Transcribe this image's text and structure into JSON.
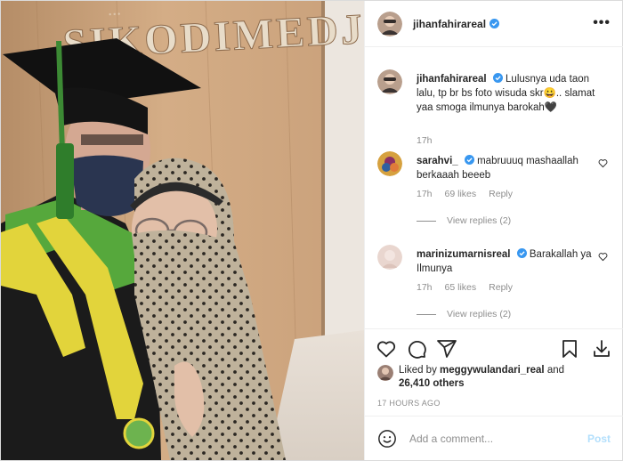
{
  "photo": {
    "sign_text": "SIKODIMEDJO",
    "description_icon": "graduation-selfie-photo"
  },
  "header": {
    "username": "jihanfahirareal",
    "verified_icon": "verified-badge-icon",
    "more_icon": "more-options-icon"
  },
  "caption": {
    "username": "jihanfahirareal",
    "text": "Lulusnya uda taon lalu, tp br bs foto wisuda skr😀.. slamat yaa smoga ilmunya barokah🖤",
    "time": "17h"
  },
  "comments": [
    {
      "username": "sarahvi_",
      "verified": true,
      "text": "mabruuuq mashaallah berkaaah beeeb",
      "time": "17h",
      "likes": "69 likes",
      "reply_label": "Reply",
      "view_replies": "View replies (2)"
    },
    {
      "username": "marinizumarnisreal",
      "verified": true,
      "text": "Barakallah ya Ilmunya",
      "time": "17h",
      "likes": "65 likes",
      "reply_label": "Reply",
      "view_replies": "View replies (2)"
    }
  ],
  "actions": {
    "like_icon": "heart-icon",
    "comment_icon": "comment-icon",
    "share_icon": "share-icon",
    "save_icon": "bookmark-icon",
    "download_icon": "download-icon"
  },
  "likes": {
    "prefix": "Liked by ",
    "user": "meggywulandari_real",
    "and": " and",
    "count": "26,410 others"
  },
  "timestamp": "17 HOURS AGO",
  "add_comment": {
    "placeholder": "Add a comment...",
    "post_label": "Post"
  },
  "colors": {
    "verified": "#3897f0",
    "link_disabled": "#b2dffc",
    "muted": "#8e8e8e"
  }
}
